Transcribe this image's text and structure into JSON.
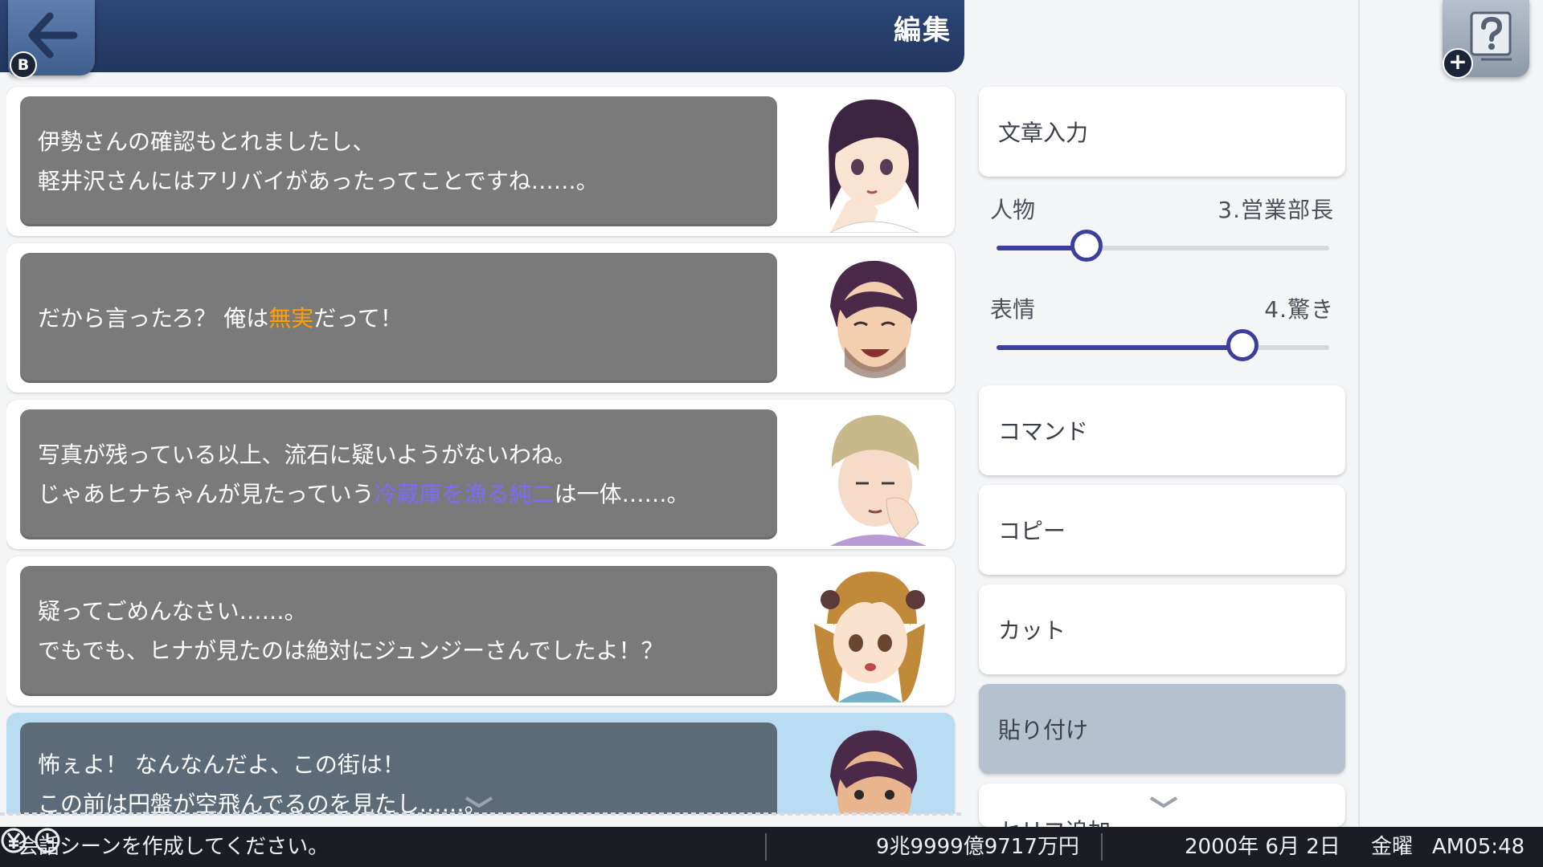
{
  "header": {
    "title": "編集",
    "back_badge": "B"
  },
  "help": {
    "icon": "help-question-icon",
    "badge": "+"
  },
  "dialogs": [
    {
      "lines": [
        [
          {
            "text": "伊勢さんの確認もとれましたし、"
          }
        ],
        [
          {
            "text": "軽井沢さんにはアリバイがあったってことですね……。"
          }
        ]
      ],
      "portrait": "dark-haired-woman-thinking-portrait"
    },
    {
      "lines": [
        [
          {
            "text": "だから言ったろ？ 俺は"
          },
          {
            "text": "無実",
            "color": "#ffa000"
          },
          {
            "text": "だって！"
          }
        ]
      ],
      "portrait": "bearded-man-laughing-portrait"
    },
    {
      "lines": [
        [
          {
            "text": "写真が残っている以上、流石に疑いようがないわね。"
          }
        ],
        [
          {
            "text": "じゃあヒナちゃんが見たっていう"
          },
          {
            "text": "冷蔵庫を漁る純二",
            "color": "#7d6bff"
          },
          {
            "text": "は一体……。"
          }
        ]
      ],
      "portrait": "blond-man-pondering-portrait"
    },
    {
      "lines": [
        [
          {
            "text": "疑ってごめんなさい……。"
          }
        ],
        [
          {
            "text": "でもでも、ヒナが見たのは絶対にジュンジーさんでしたよ！？"
          }
        ]
      ],
      "portrait": "twin-tail-girl-worried-portrait"
    },
    {
      "lines": [
        [
          {
            "text": "怖ぇよ！ なんなんだよ、この街は！"
          }
        ],
        [
          {
            "text": "この前は円盤が空飛んでるのを見たし……。"
          }
        ]
      ],
      "portrait": "bearded-man-surprised-portrait",
      "selected": true
    }
  ],
  "panel": {
    "text_input": "文章入力",
    "character": {
      "label": "人物",
      "value": "3.営業部長",
      "level": 0.27
    },
    "expression": {
      "label": "表情",
      "value": "4.驚き",
      "level": 0.74
    },
    "command": "コマンド",
    "copy": "コピー",
    "cut": "カット",
    "paste": "貼り付け",
    "add_line": "セリフ追加"
  },
  "status": {
    "message": "会話シーンを作成してください。",
    "money": "9兆9999億9717万円",
    "date": "2000年 6月 2日",
    "weekday": "金曜",
    "time": "AM05:48"
  },
  "colors": {
    "header_bg": "#2d4677",
    "bubble_bg": "#7a7a7a",
    "selected_row": "#b8dcf1",
    "slider_accent": "#3d3f9e",
    "paste_active": "#b5c2cd"
  }
}
